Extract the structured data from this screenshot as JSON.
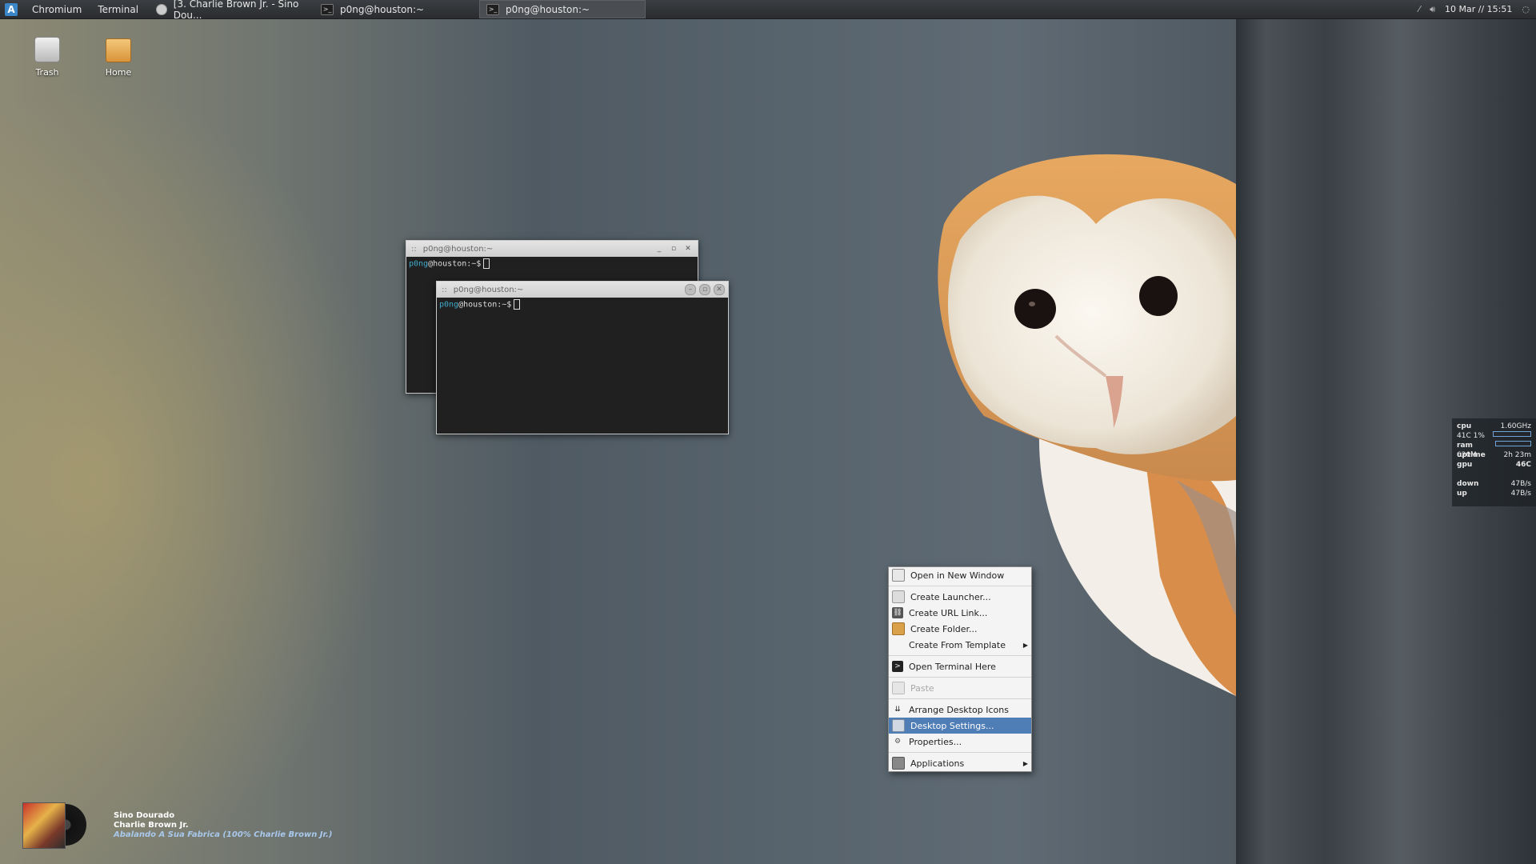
{
  "panel": {
    "launchers": [
      "Chromium",
      "Terminal"
    ],
    "tasks": [
      "[3. Charlie Brown Jr. - Sino Dou...",
      "p0ng@houston:~",
      "p0ng@houston:~"
    ],
    "clock": "10 Mar // 15:51"
  },
  "desktop_icons": [
    {
      "label": "Trash",
      "icon": "trash-icon"
    },
    {
      "label": "Home",
      "icon": "folder-icon"
    }
  ],
  "terminals": [
    {
      "title": "p0ng@houston:~",
      "user": "p0ng",
      "host_prompt": "@houston:~$"
    },
    {
      "title": "p0ng@houston:~",
      "user": "p0ng",
      "host_prompt": "@houston:~$"
    }
  ],
  "context_menu": {
    "items": [
      {
        "label": "Open in New Window",
        "icon": "window-icon"
      },
      {
        "label": "Create Launcher...",
        "icon": "launcher-icon"
      },
      {
        "label": "Create URL Link...",
        "icon": "link-icon"
      },
      {
        "label": "Create Folder...",
        "icon": "folder-icon"
      },
      {
        "label": "Create From Template",
        "icon": "",
        "submenu": true
      },
      {
        "label": "Open Terminal Here",
        "icon": "terminal-icon"
      },
      {
        "label": "Paste",
        "icon": "paste-icon",
        "disabled": true
      },
      {
        "label": "Arrange Desktop Icons",
        "icon": "arrange-icon"
      },
      {
        "label": "Desktop Settings...",
        "icon": "settings-icon",
        "selected": true
      },
      {
        "label": "Properties...",
        "icon": "gear-icon"
      },
      {
        "label": "Applications",
        "icon": "applications-icon",
        "submenu": true
      }
    ]
  },
  "sysmon": {
    "cpu_label": "cpu",
    "cpu_freq": "1.60GHz",
    "cpu_temp": "41C",
    "cpu_usage": "1%",
    "ram_label": "ram",
    "ram_value": "620M",
    "uptime_label": "uptime",
    "uptime_value": "2h 23m",
    "gpu_label": "gpu",
    "gpu_value": "46C",
    "down_label": "down",
    "down_value": "47B/s",
    "up_label": "up",
    "up_value": "47B/s"
  },
  "now_playing": {
    "title": "Sino Dourado",
    "artist": "Charlie Brown Jr.",
    "album": "Abalando A Sua Fabrica (100% Charlie Brown Jr.)"
  },
  "colors": {
    "panel_bg": "#2f3134",
    "menu_highlight": "#4f7db5",
    "terminal_user": "#3fa9c8"
  }
}
